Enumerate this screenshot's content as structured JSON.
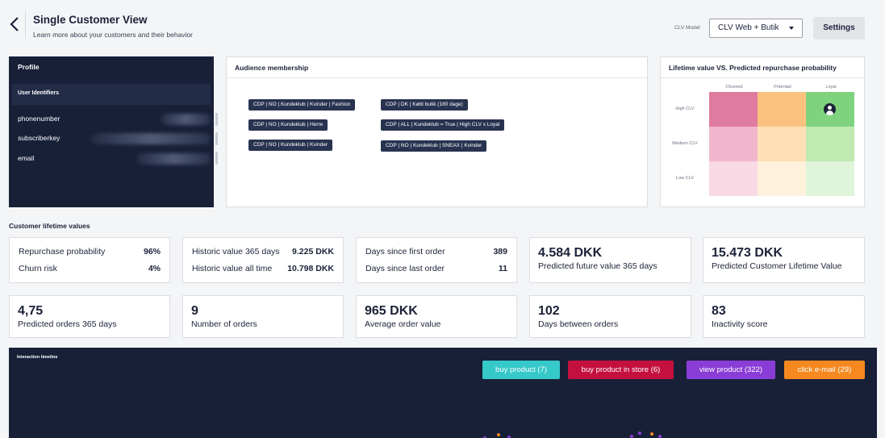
{
  "header": {
    "title": "Single Customer View",
    "subtitle": "Learn more about your customers and their behavior",
    "clv_model_label": "CLV Model",
    "clv_model_value": "CLV Web + Butik",
    "settings_label": "Settings"
  },
  "profile": {
    "title": "Profile",
    "identifiers_heading": "User Identifiers",
    "identifiers": [
      {
        "label": "phonenumber"
      },
      {
        "label": "subscriberkey"
      },
      {
        "label": "email"
      }
    ]
  },
  "audience": {
    "title": "Audience membership",
    "tags_left": [
      "CDP | NO | Kundeklub | Kvinder | Fashion",
      "CDP | NO | Kundeklub | Herre",
      "CDP | NO | Kundeklub | Kvinder"
    ],
    "tags_right": [
      "CDP | DK | Købt butik (180 dage)",
      "CDP | ALL | Kundeklub = True | High CLV x Loyal",
      "CDP | NO | Kundeklub | SNEAX | Kvinder"
    ]
  },
  "ltv_matrix": {
    "title": "Lifetime value VS. Predicted repurchase probability",
    "columns": [
      "Churned",
      "Potential",
      "Loyal"
    ],
    "rows": [
      "High CLV",
      "Medium CLV",
      "Low CLV"
    ],
    "colors": [
      [
        "#e07ba0",
        "#fbc27f",
        "#7fd37f"
      ],
      [
        "#f1b6cb",
        "#fde0b5",
        "#bfeab0"
      ],
      [
        "#f8d9e4",
        "#fff1dc",
        "#dff5da"
      ]
    ],
    "customer_cell": {
      "row": "High CLV",
      "column": "Loyal"
    }
  },
  "clv_section_label": "Customer lifetime values",
  "kpi_pairs": [
    {
      "rows": [
        {
          "label": "Repurchase probability",
          "value": "96%"
        },
        {
          "label": "Churn risk",
          "value": "4%"
        }
      ]
    },
    {
      "rows": [
        {
          "label": "Historic value 365 days",
          "value": "9.225 DKK"
        },
        {
          "label": "Historic value all time",
          "value": "10.798 DKK"
        }
      ]
    },
    {
      "rows": [
        {
          "label": "Days since first order",
          "value": "389"
        },
        {
          "label": "Days since last order",
          "value": "11"
        }
      ]
    }
  ],
  "kpi_big_top": [
    {
      "value": "4.584 DKK",
      "label": "Predicted future value 365 days"
    },
    {
      "value": "15.473 DKK",
      "label": "Predicted Customer Lifetime Value"
    }
  ],
  "kpi_big_bottom": [
    {
      "value": "4,75",
      "label": "Predicted orders 365 days"
    },
    {
      "value": "9",
      "label": "Number of orders"
    },
    {
      "value": "965 DKK",
      "label": "Average order value"
    },
    {
      "value": "102",
      "label": "Days between orders"
    },
    {
      "value": "83",
      "label": "Inactivity score"
    }
  ],
  "timeline": {
    "title": "Interaction timeline",
    "legend": [
      {
        "label": "buy product (7)",
        "color": "#35c9c9"
      },
      {
        "label": "buy product in store (6)",
        "color": "#c4103f"
      },
      {
        "label": "view product (322)",
        "color": "#8a3dd6"
      },
      {
        "label": "click e-mail (29)",
        "color": "#f5891f"
      }
    ]
  }
}
